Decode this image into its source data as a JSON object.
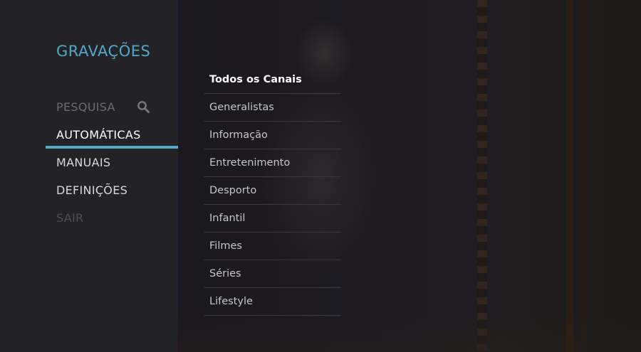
{
  "sidebar": {
    "title": "GRAVAÇÕES",
    "items": [
      {
        "label": "PESQUISA",
        "icon": "search-icon"
      },
      {
        "label": "AUTOMÁTICAS"
      },
      {
        "label": "MANUAIS"
      },
      {
        "label": "DEFINIÇÕES"
      },
      {
        "label": "SAIR"
      }
    ]
  },
  "channels": {
    "items": [
      {
        "label": "Todos os Canais"
      },
      {
        "label": "Generalistas"
      },
      {
        "label": "Informação"
      },
      {
        "label": "Entretenimento"
      },
      {
        "label": "Desporto"
      },
      {
        "label": "Infantil"
      },
      {
        "label": "Filmes"
      },
      {
        "label": "Séries"
      },
      {
        "label": "Lifestyle"
      }
    ]
  },
  "colors": {
    "accent": "#4fa9c7",
    "sidebar_bg": "#232327",
    "text": "#d9d9d9"
  }
}
